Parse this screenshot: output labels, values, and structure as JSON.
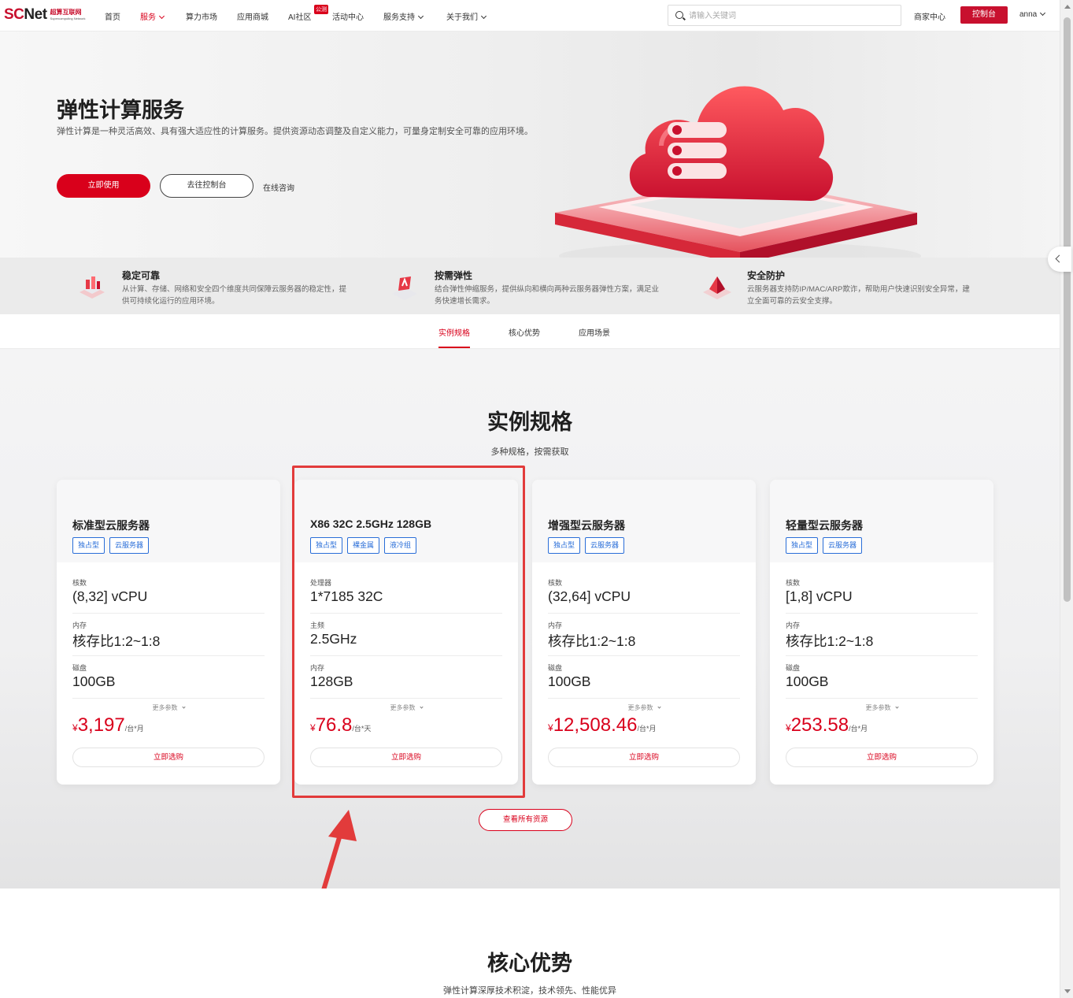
{
  "brand": {
    "logo_main_a": "SC",
    "logo_main_b": "Net",
    "logo_cn": "超算互联网",
    "logo_en": "Supercomputing Network",
    "accent": "#d9001b"
  },
  "nav": {
    "items": [
      {
        "label": "首页",
        "dropdown": false,
        "active": false
      },
      {
        "label": "服务",
        "dropdown": true,
        "active": true
      },
      {
        "label": "算力市场",
        "dropdown": false,
        "active": false
      },
      {
        "label": "应用商城",
        "dropdown": false,
        "active": false
      },
      {
        "label": "AI社区",
        "dropdown": false,
        "active": false
      },
      {
        "label": "活动中心",
        "dropdown": false,
        "active": false
      },
      {
        "label": "服务支持",
        "dropdown": true,
        "active": false
      },
      {
        "label": "关于我们",
        "dropdown": true,
        "active": false
      }
    ],
    "beta_badge": "公测",
    "search_placeholder": "请输入关键词",
    "merchant": "商家中心",
    "console": "控制台",
    "user": "anna"
  },
  "hero": {
    "title": "弹性计算服务",
    "desc": "弹性计算是一种灵活高效、具有强大适应性的计算服务。提供资源动态调整及自定义能力，可量身定制安全可靠的应用环境。",
    "btn_primary": "立即使用",
    "btn_console": "去往控制台",
    "consult": "在线咨询"
  },
  "features": [
    {
      "title": "稳定可靠",
      "desc": "从计算、存储、网络和安全四个维度共同保障云服务器的稳定性，提供可持续化运行的应用环境。",
      "icon": "stack-icon"
    },
    {
      "title": "按需弹性",
      "desc": "结合弹性伸缩服务，提供纵向和横向两种云服务器弹性方案，满足业务快速增长需求。",
      "icon": "scale-icon"
    },
    {
      "title": "安全防护",
      "desc": "云服务器支持防IP/MAC/ARP欺诈，帮助用户快速识别安全异常，建立全面可靠的云安全支撑。",
      "icon": "shield-icon"
    }
  ],
  "tabs": [
    {
      "label": "实例规格",
      "active": true
    },
    {
      "label": "核心优势",
      "active": false
    },
    {
      "label": "应用场景",
      "active": false
    }
  ],
  "specs": {
    "title": "实例规格",
    "subtitle": "多种规格，按需获取",
    "more_label": "更多参数",
    "buy_label": "立即选购",
    "view_all": "查看所有资源",
    "cards": [
      {
        "name": "标准型云服务器",
        "tags": [
          "独占型",
          "云服务器"
        ],
        "rows": [
          {
            "label": "核数",
            "value": "(8,32] vCPU"
          },
          {
            "label": "内存",
            "value": "核存比1:2~1:8"
          },
          {
            "label": "磁盘",
            "value": "100GB"
          }
        ],
        "currency": "¥",
        "price": "3,197",
        "unit": "/台*月"
      },
      {
        "name": "X86 32C 2.5GHz 128GB",
        "tags": [
          "独占型",
          "裸金属",
          "液冷组"
        ],
        "rows": [
          {
            "label": "处理器",
            "value": "1*7185 32C"
          },
          {
            "label": "主频",
            "value": "2.5GHz"
          },
          {
            "label": "内存",
            "value": "128GB"
          }
        ],
        "currency": "¥",
        "price": "76.8",
        "unit": "/台*天"
      },
      {
        "name": "增强型云服务器",
        "tags": [
          "独占型",
          "云服务器"
        ],
        "rows": [
          {
            "label": "核数",
            "value": "(32,64] vCPU"
          },
          {
            "label": "内存",
            "value": "核存比1:2~1:8"
          },
          {
            "label": "磁盘",
            "value": "100GB"
          }
        ],
        "currency": "¥",
        "price": "12,508.46",
        "unit": "/台*月"
      },
      {
        "name": "轻量型云服务器",
        "tags": [
          "独占型",
          "云服务器"
        ],
        "rows": [
          {
            "label": "核数",
            "value": "[1,8] vCPU"
          },
          {
            "label": "内存",
            "value": "核存比1:2~1:8"
          },
          {
            "label": "磁盘",
            "value": "100GB"
          }
        ],
        "currency": "¥",
        "price": "253.58",
        "unit": "/台*月"
      }
    ]
  },
  "core": {
    "title": "核心优势",
    "subtitle": "弹性计算深厚技术积淀，技术领先、性能优异"
  },
  "colors": {
    "tag_blue": "#2a6ed8",
    "price_red": "#d9001b",
    "annotation_red": "#e23b3b"
  }
}
